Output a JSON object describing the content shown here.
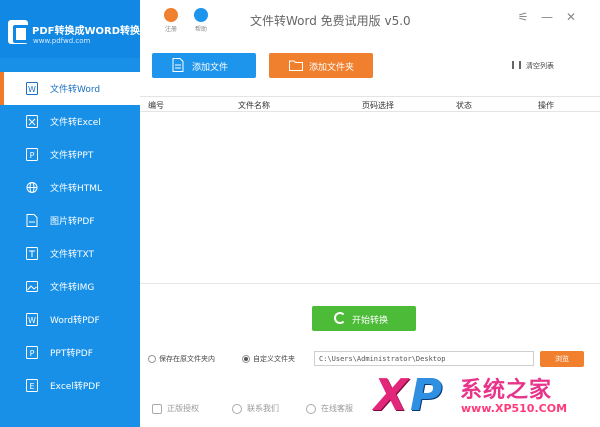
{
  "brand": {
    "title": "PDF转换成WORD转换器",
    "url": "www.pdfwd.com"
  },
  "sidebar": {
    "items": [
      {
        "label": "文件转Word",
        "icon": "word-icon",
        "active": true
      },
      {
        "label": "文件转Excel",
        "icon": "excel-icon",
        "active": false
      },
      {
        "label": "文件转PPT",
        "icon": "ppt-icon",
        "active": false
      },
      {
        "label": "文件转HTML",
        "icon": "globe-icon",
        "active": false
      },
      {
        "label": "图片转PDF",
        "icon": "image-file-icon",
        "active": false
      },
      {
        "label": "文件转TXT",
        "icon": "txt-icon",
        "active": false
      },
      {
        "label": "文件转IMG",
        "icon": "image-icon",
        "active": false
      },
      {
        "label": "Word转PDF",
        "icon": "word-pdf-icon",
        "active": false
      },
      {
        "label": "PPT转PDF",
        "icon": "ppt-pdf-icon",
        "active": false
      },
      {
        "label": "Excel转PDF",
        "icon": "excel-pdf-icon",
        "active": false
      }
    ]
  },
  "topbar": {
    "title": "文件转Word 免费试用版 v5.0",
    "buttons": [
      {
        "caption": "注册",
        "color": "#f07f2e"
      },
      {
        "caption": "帮助",
        "color": "#1e95ec"
      }
    ]
  },
  "actions": {
    "add_file": "添加文件",
    "add_folder": "添加文件夹",
    "clear_list": "清空列表"
  },
  "table": {
    "columns": [
      "编号",
      "文件名称",
      "页码选择",
      "状态",
      "操作"
    ],
    "rows": []
  },
  "start": {
    "label": "开始转换"
  },
  "save": {
    "option_source": "保存在原文件夹内",
    "option_custom": "自定义文件夹",
    "selected": "custom",
    "path": "C:\\Users\\Administrator\\Desktop",
    "browse": "浏览"
  },
  "footer": {
    "items": [
      "正版授权",
      "联系我们",
      "在线客服"
    ]
  },
  "watermark": {
    "logo_x": "X",
    "logo_p": "P",
    "text": "系统之家",
    "url": "www.XP510.COM"
  },
  "colors": {
    "sidebar": "#1890e8",
    "accent_blue": "#1e95ec",
    "accent_orange": "#f07f2e",
    "start_green": "#4cbb37"
  }
}
